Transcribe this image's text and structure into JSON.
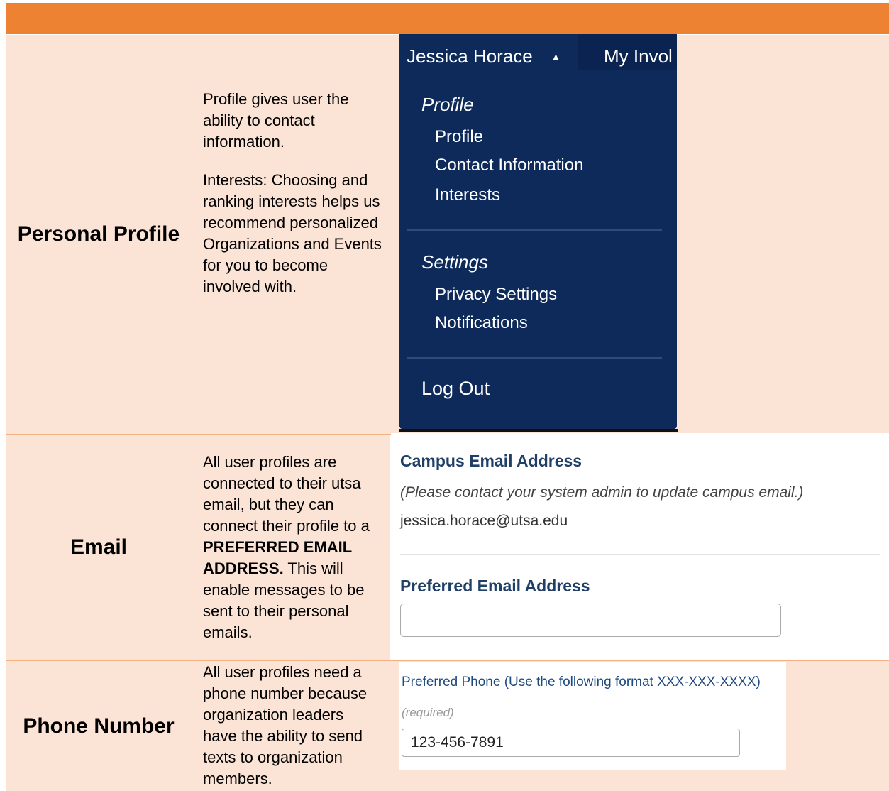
{
  "colors": {
    "header": "#EE8233",
    "cell_fill": "#FBE4D5",
    "grid_line": "#F4B183",
    "menu_bg": "#0E2A5A",
    "email_title": "#1F3F66",
    "phone_label": "#1F4A80"
  },
  "rows": [
    {
      "label": "Personal Profile",
      "desc_1": "Profile gives user the ability to contact information.",
      "desc_2": "Interests: Choosing and ranking interests helps us recommend personalized Organizations and Events for you to become involved with."
    },
    {
      "label": "Email",
      "desc_1": "All user profiles are connected to their utsa email, but they can connect their profile to a",
      "desc_bold": "PREFERRED EMAIL ADDRESS.",
      "desc_2": "This will enable messages to be sent to their personal emails."
    },
    {
      "label": "Phone Number",
      "desc_1": "All user profiles need a phone number because organization leaders have the ability to send texts to organization members."
    }
  ],
  "menu": {
    "user_name": "Jessica Horace",
    "caret_icon": "caret-up-icon",
    "next_tab": "My Invol",
    "profile_section": "Profile",
    "profile_items": [
      "Profile",
      "Contact Information",
      "Interests"
    ],
    "settings_section": "Settings",
    "settings_items": [
      "Privacy Settings",
      "Notifications"
    ],
    "logout": "Log Out"
  },
  "email_panel": {
    "campus_title": "Campus Email Address",
    "campus_note": "(Please contact your system admin to update campus email.)",
    "campus_value": "jessica.horace@utsa.edu",
    "preferred_title": "Preferred Email Address",
    "preferred_value": ""
  },
  "phone_panel": {
    "label": "Preferred Phone (Use the following format XXX-XXX-XXXX)",
    "required": "(required)",
    "value": "123-456-7891"
  }
}
